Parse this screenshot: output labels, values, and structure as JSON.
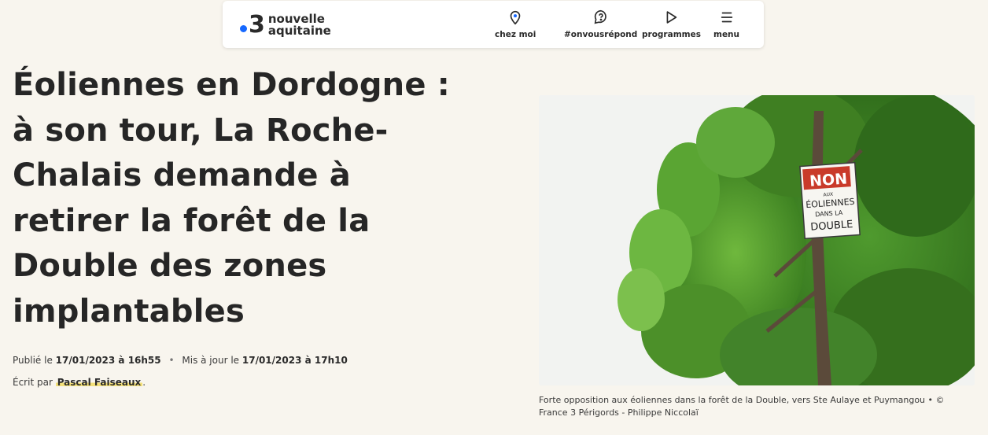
{
  "brand": {
    "number": "3",
    "line1": "nouvelle",
    "line2": "aquitaine",
    "dot_color": "#1668ff"
  },
  "nav": {
    "chez_moi": "chez moi",
    "onvousrepond": "#onvousrépond",
    "programmes": "programmes",
    "menu": "menu"
  },
  "article": {
    "title_lines": [
      "Éoliennes en Dordogne :",
      "à son tour, La Roche-",
      "Chalais demande à",
      "retirer la forêt de la",
      "Double des zones",
      "implantables"
    ],
    "published_label": "Publié le",
    "published_value": "17/01/2023 à 16h55",
    "separator": "•",
    "updated_label": "Mis à jour le",
    "updated_value": "17/01/2023 à 17h10",
    "author_label": "Écrit par",
    "author_name": "Pascal Faiseaux",
    "author_suffix": "."
  },
  "image": {
    "sign_line1": "NON",
    "sign_line2": "AUX",
    "sign_line3": "ÉOLIENNES",
    "sign_line4": "DANS LA",
    "sign_line5": "DOUBLE",
    "caption": "Forte opposition aux éoliennes dans la forêt de la Double, vers Ste Aulaye et Puymangou • © France 3 Périgords - Philippe Niccolaï"
  }
}
